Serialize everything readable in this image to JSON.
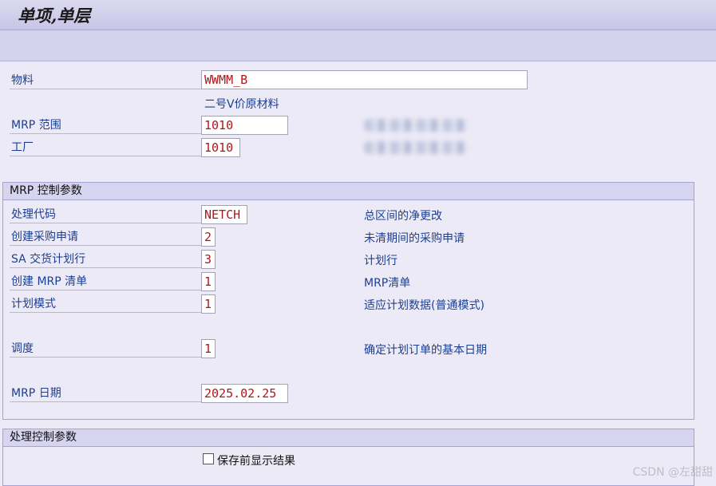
{
  "window": {
    "title": "单项,单层"
  },
  "header": {
    "material": {
      "label": "物料",
      "value": "WWMM_B",
      "description": "二号V价原材料"
    },
    "mrp_area": {
      "label": "MRP 范围",
      "value": "1010"
    },
    "plant": {
      "label": "工厂",
      "value": "1010"
    }
  },
  "mrp_control": {
    "title": "MRP 控制参数",
    "rows": [
      {
        "label": "处理代码",
        "value": "NETCH",
        "description": "总区间的净更改"
      },
      {
        "label": "创建采购申请",
        "value": "2",
        "description": "未清期间的采购申请"
      },
      {
        "label": "SA 交货计划行",
        "value": "3",
        "description": "计划行"
      },
      {
        "label": "创建 MRP 清单",
        "value": "1",
        "description": "MRP清单"
      },
      {
        "label": "计划模式",
        "value": "1",
        "description": "适应计划数据(普通模式)"
      },
      {
        "label": "调度",
        "value": "1",
        "description": "确定计划订单的基本日期"
      },
      {
        "label": "MRP 日期",
        "value": "2025.02.25",
        "description": ""
      }
    ]
  },
  "processing_control": {
    "title": "处理控制参数",
    "display_results_before_save": {
      "label": "保存前显示结果",
      "checked": false
    }
  },
  "watermark": "CSDN @左甜甜"
}
